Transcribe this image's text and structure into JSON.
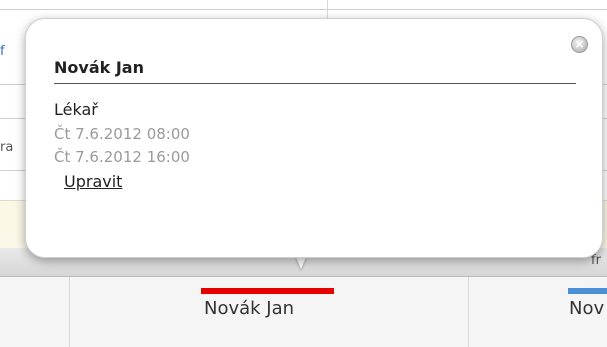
{
  "background": {
    "fragments": [
      "f",
      "ra",
      "fr"
    ],
    "events": [
      {
        "label": "Novák Jan",
        "color": "#e60000"
      },
      {
        "label": "Nov",
        "color": "#4a90d9"
      }
    ]
  },
  "popup": {
    "title": "Novák Jan",
    "role": "Lékař",
    "start": "Čt 7.6.2012 08:00",
    "end": "Čt 7.6.2012 16:00",
    "edit_label": "Upravit",
    "close_icon": "close-icon"
  }
}
